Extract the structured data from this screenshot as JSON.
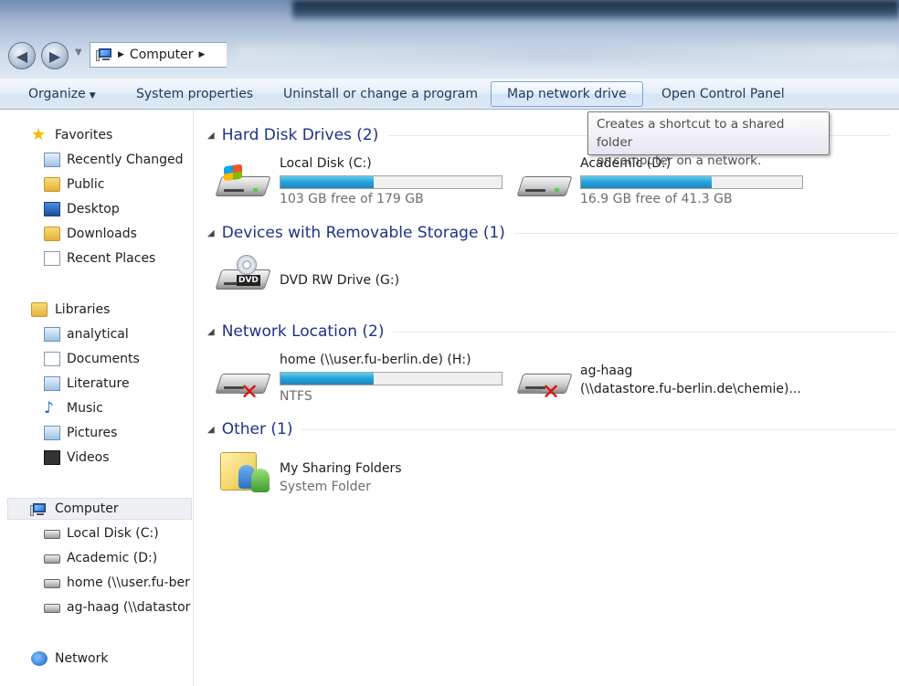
{
  "address": {
    "crumbs": [
      "Computer"
    ]
  },
  "command_bar": {
    "organize": "Organize",
    "system_properties": "System properties",
    "uninstall": "Uninstall or change a program",
    "map_drive": "Map network drive",
    "control_panel": "Open Control Panel"
  },
  "tooltip": {
    "line1": "Creates a shortcut to a shared folder",
    "line2": "or computer on a network."
  },
  "nav": {
    "favorites": "Favorites",
    "recently_changed": "Recently Changed",
    "public": "Public",
    "desktop": "Desktop",
    "downloads": "Downloads",
    "recent_places": "Recent Places",
    "libraries": "Libraries",
    "analytical": "analytical",
    "documents": "Documents",
    "literature": "Literature",
    "music": "Music",
    "pictures": "Pictures",
    "videos": "Videos",
    "computer": "Computer",
    "local_disk": "Local Disk (C:)",
    "academic": "Academic (D:)",
    "home": "home (\\\\user.fu-ber",
    "ag_haag": "ag-haag (\\\\datastor",
    "network": "Network"
  },
  "groups": {
    "hard_disks": "Hard Disk Drives (2)",
    "removable": "Devices with Removable Storage (1)",
    "network": "Network Location (2)",
    "other": "Other (1)"
  },
  "drives": {
    "c_name": "Local Disk (C:)",
    "c_free": "103 GB free of 179 GB",
    "c_used_fraction": 0.42,
    "d_name": "Academic (D:)",
    "d_free": "16.9 GB free of 41.3 GB",
    "d_used_fraction": 0.59,
    "dvd_name": "DVD RW Drive (G:)",
    "dvd_badge": "DVD",
    "h_name": "home (\\\\user.fu-berlin.de) (H:)",
    "h_fs": "NTFS",
    "h_used_fraction": 0.42,
    "ag_name": "ag-haag",
    "ag_path": "(\\\\datastore.fu-berlin.de\\chemie)...",
    "sharing_name": "My Sharing Folders",
    "sharing_sub": "System Folder"
  }
}
